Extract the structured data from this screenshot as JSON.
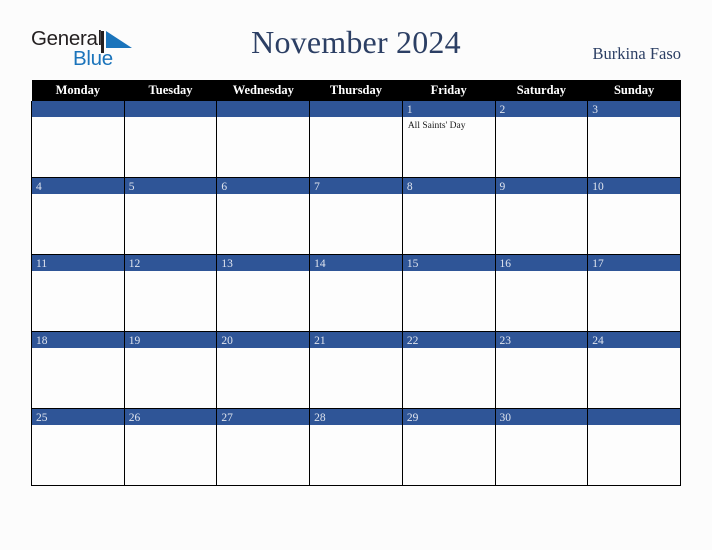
{
  "brand": {
    "name_part1": "General",
    "name_part2": "Blue",
    "mark_icon": "triangle-flag-icon",
    "color_dark": "#231f20",
    "color_blue": "#1b74bb"
  },
  "header": {
    "title": "November 2024",
    "country": "Burkina Faso",
    "title_color": "#2c3f64"
  },
  "calendar": {
    "header_background": "#000000",
    "daynum_band_color": "#2f5597",
    "weekday_headers": [
      "Monday",
      "Tuesday",
      "Wednesday",
      "Thursday",
      "Friday",
      "Saturday",
      "Sunday"
    ],
    "weeks": [
      [
        {
          "day": "",
          "events": []
        },
        {
          "day": "",
          "events": []
        },
        {
          "day": "",
          "events": []
        },
        {
          "day": "",
          "events": []
        },
        {
          "day": "1",
          "events": [
            "All Saints' Day"
          ]
        },
        {
          "day": "2",
          "events": []
        },
        {
          "day": "3",
          "events": []
        }
      ],
      [
        {
          "day": "4",
          "events": []
        },
        {
          "day": "5",
          "events": []
        },
        {
          "day": "6",
          "events": []
        },
        {
          "day": "7",
          "events": []
        },
        {
          "day": "8",
          "events": []
        },
        {
          "day": "9",
          "events": []
        },
        {
          "day": "10",
          "events": []
        }
      ],
      [
        {
          "day": "11",
          "events": []
        },
        {
          "day": "12",
          "events": []
        },
        {
          "day": "13",
          "events": []
        },
        {
          "day": "14",
          "events": []
        },
        {
          "day": "15",
          "events": []
        },
        {
          "day": "16",
          "events": []
        },
        {
          "day": "17",
          "events": []
        }
      ],
      [
        {
          "day": "18",
          "events": []
        },
        {
          "day": "19",
          "events": []
        },
        {
          "day": "20",
          "events": []
        },
        {
          "day": "21",
          "events": []
        },
        {
          "day": "22",
          "events": []
        },
        {
          "day": "23",
          "events": []
        },
        {
          "day": "24",
          "events": []
        }
      ],
      [
        {
          "day": "25",
          "events": []
        },
        {
          "day": "26",
          "events": []
        },
        {
          "day": "27",
          "events": []
        },
        {
          "day": "28",
          "events": []
        },
        {
          "day": "29",
          "events": []
        },
        {
          "day": "30",
          "events": []
        },
        {
          "day": "",
          "events": []
        }
      ]
    ]
  }
}
